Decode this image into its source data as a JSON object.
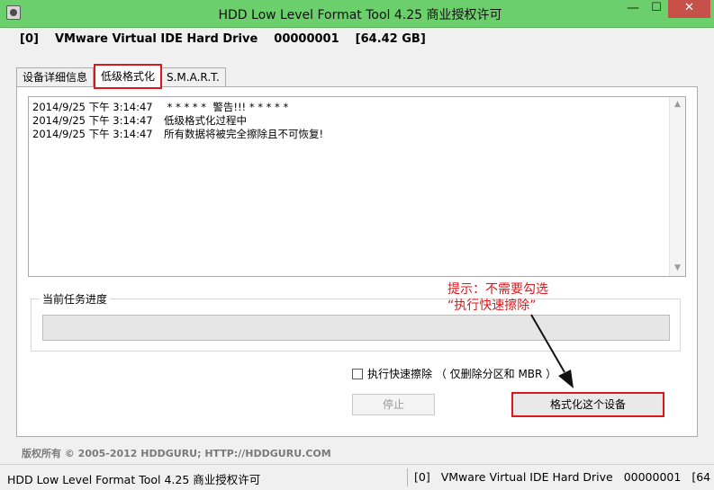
{
  "window": {
    "title": "HDD Low Level Format Tool 4.25   商业授权许可",
    "minimize": "—",
    "maximize": "☐",
    "close": "✕"
  },
  "device": {
    "index": "[0]",
    "name": "VMware Virtual IDE Hard Drive",
    "serial": "00000001",
    "size": "[64.42 GB]"
  },
  "tabs": [
    {
      "label": "设备详细信息",
      "active": false
    },
    {
      "label": "低级格式化",
      "active": true
    },
    {
      "label": "S.M.A.R.T.",
      "active": false
    }
  ],
  "log": [
    {
      "time": "2014/9/25 下午 3:14:47",
      "message": " * * * * *  警告!!! * * * * *"
    },
    {
      "time": "2014/9/25 下午 3:14:47",
      "message": "低级格式化过程中"
    },
    {
      "time": "2014/9/25 下午 3:14:47",
      "message": "所有数据将被完全擦除且不可恢复!"
    }
  ],
  "progress": {
    "label": "当前任务进度",
    "value": 0
  },
  "hint": {
    "line1": "提示：不需要勾选",
    "line2": "“执行快速擦除”"
  },
  "quick_wipe": {
    "label": "执行快速擦除 （ 仅删除分区和 MBR ）",
    "checked": false
  },
  "buttons": {
    "stop": "停止",
    "format": "格式化这个设备"
  },
  "copyright": "版权所有 © 2005-2012 HDDGURU;  HTTP://HDDGURU.COM",
  "statusbar": {
    "left": "HDD Low Level Format Tool 4.25    商业授权许可",
    "right": {
      "index": "[0]",
      "name": "VMware Virtual IDE Hard Drive",
      "serial": "00000001",
      "size": "[64"
    }
  },
  "colors": {
    "titlebar": "#6bcf6b",
    "highlight": "#e0161b",
    "close": "#c7504b"
  }
}
